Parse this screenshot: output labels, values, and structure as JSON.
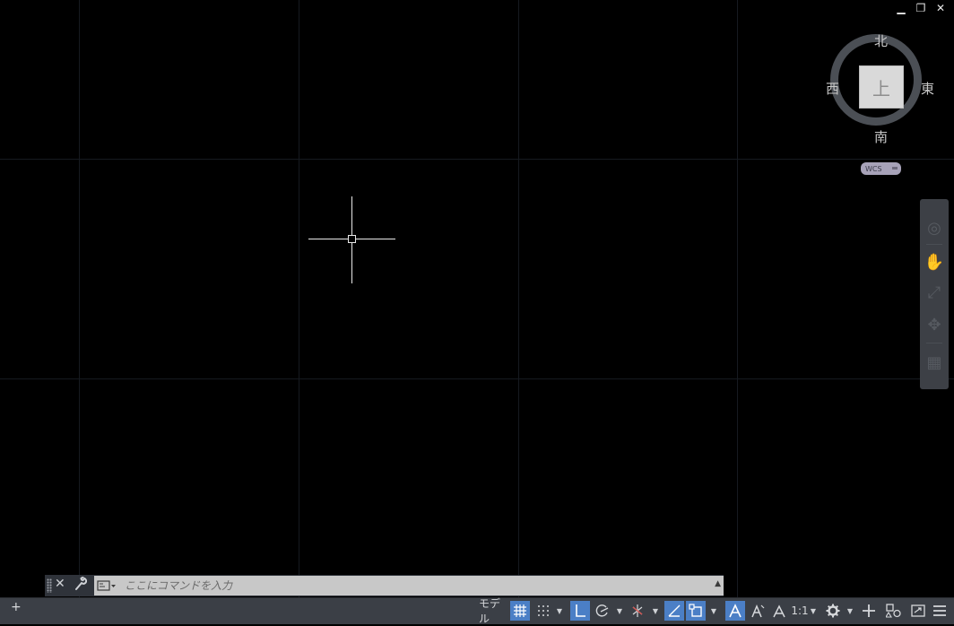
{
  "window_controls": {
    "minimize": "▁",
    "restore": "❐",
    "close": "✕"
  },
  "viewcube": {
    "north": "北",
    "south": "南",
    "east": "東",
    "west": "西",
    "face": "上",
    "ucs_menu": "WCS"
  },
  "navbar": {
    "items": [
      "full-navigation-wheel",
      "pan",
      "zoom-extents",
      "orbit",
      "showmotion"
    ]
  },
  "command_line": {
    "placeholder": "ここにコマンドを入力",
    "value": "",
    "close_glyph": "✕",
    "customize_glyph": "🔧",
    "prompt_glyph": "▭▾",
    "history_glyph": "▲"
  },
  "statusbar": {
    "add_layout": "+",
    "model_label": "モデル",
    "grid_on": true,
    "snap_on": false,
    "ortho_on": true,
    "polar_on": false,
    "isodraft_on": false,
    "osnap_tracking_on": true,
    "osnap_on": true,
    "annotation_visibility_on": true,
    "annotation_scale": "1:1"
  }
}
